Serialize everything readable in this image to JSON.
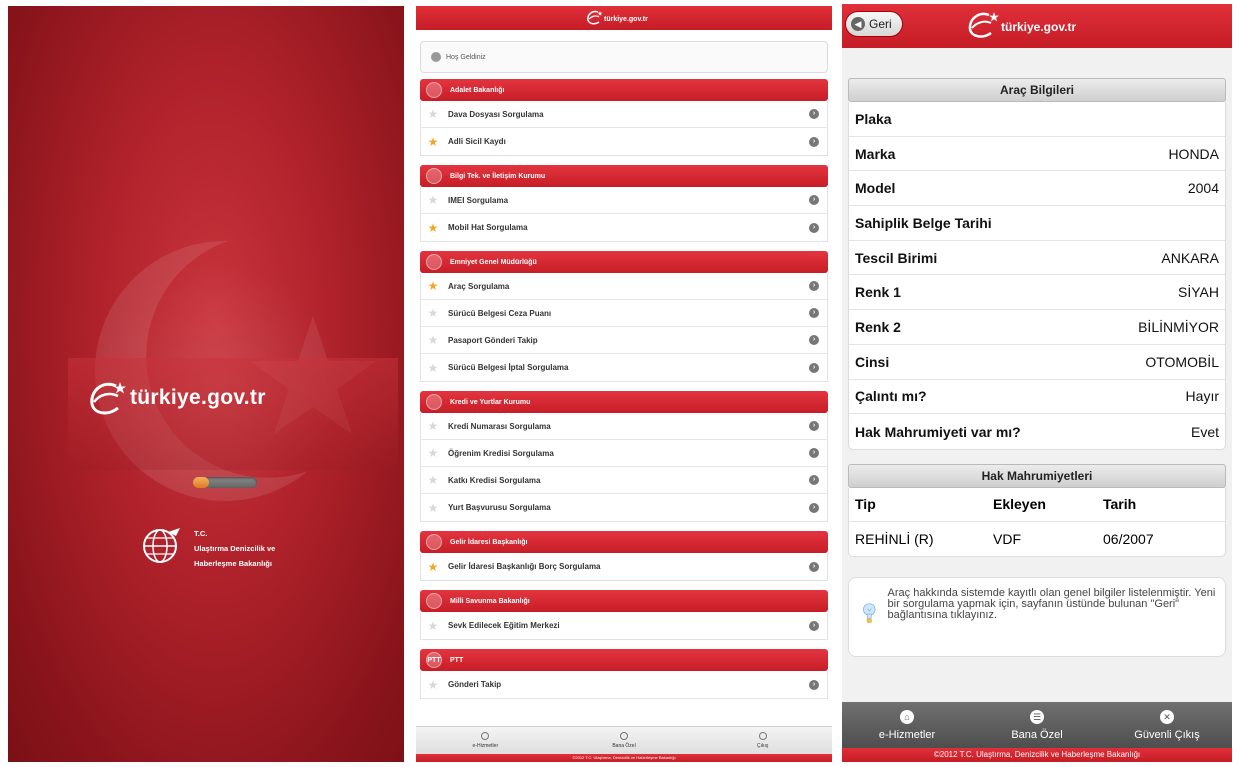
{
  "colors": {
    "brand_red": "#c51c26",
    "star_active": "#f4a623"
  },
  "splash": {
    "logo_text": "türkiye.gov.tr",
    "progress": 0.25,
    "ministry_lines": [
      "T.C.",
      "Ulaştırma Denizcilik ve",
      "Haberleşme Bakanlığı"
    ]
  },
  "list": {
    "welcome_text": "Hoş Geldiniz",
    "groups": [
      {
        "title": "Adalet Bakanlığı",
        "items": [
          {
            "label": "Dava Dosyası Sorgulama",
            "starred": false
          },
          {
            "label": "Adli Sicil Kaydı",
            "starred": true
          }
        ]
      },
      {
        "title": "Bilgi Tek. ve İletişim Kurumu",
        "items": [
          {
            "label": "IMEI Sorgulama",
            "starred": false
          },
          {
            "label": "Mobil Hat Sorgulama",
            "starred": true
          }
        ]
      },
      {
        "title": "Emniyet Genel Müdürlüğü",
        "items": [
          {
            "label": "Araç Sorgulama",
            "starred": true
          },
          {
            "label": "Sürücü Belgesi Ceza Puanı",
            "starred": false
          },
          {
            "label": "Pasaport Gönderi Takip",
            "starred": false
          },
          {
            "label": "Sürücü Belgesi İptal Sorgulama",
            "starred": false
          }
        ]
      },
      {
        "title": "Kredi ve Yurtlar Kurumu",
        "items": [
          {
            "label": "Kredi Numarası Sorgulama",
            "starred": false
          },
          {
            "label": "Öğrenim Kredisi Sorgulama",
            "starred": false
          },
          {
            "label": "Katkı Kredisi Sorgulama",
            "starred": false
          },
          {
            "label": "Yurt Başvurusu Sorgulama",
            "starred": false
          }
        ]
      },
      {
        "title": "Gelir İdaresi Başkanlığı",
        "items": [
          {
            "label": "Gelir İdaresi Başkanlığı Borç Sorgulama",
            "starred": true
          }
        ]
      },
      {
        "title": "Milli Savunma Bakanlığı",
        "items": [
          {
            "label": "Sevk Edilecek Eğitim Merkezi",
            "starred": false
          }
        ]
      },
      {
        "title": "PTT",
        "emblem": "PTT",
        "items": [
          {
            "label": "Gönderi Takip",
            "starred": false
          }
        ]
      }
    ],
    "tabs": [
      "e-Hizmetler",
      "Bana Özel",
      "Çıkış"
    ],
    "footer": "©2012 T.C. Ulaştırma, Denizcilik ve Haberleşme Bakanlığı"
  },
  "detail": {
    "back_label": "Geri",
    "logo_text": "türkiye.gov.tr",
    "vehicle_section_title": "Araç Bilgileri",
    "vehicle_fields": [
      {
        "key": "Plaka",
        "value": ""
      },
      {
        "key": "Marka",
        "value": "HONDA"
      },
      {
        "key": "Model",
        "value": "2004"
      },
      {
        "key": "Sahiplik Belge Tarihi",
        "value": ""
      },
      {
        "key": "Tescil Birimi",
        "value": "ANKARA"
      },
      {
        "key": "Renk 1",
        "value": "SİYAH"
      },
      {
        "key": "Renk 2",
        "value": "BİLİNMİYOR"
      },
      {
        "key": "Cinsi",
        "value": "OTOMOBİL"
      },
      {
        "key": "Çalıntı mı?",
        "value": "Hayır"
      },
      {
        "key": "Hak Mahrumiyeti var mı?",
        "value": "Evet"
      }
    ],
    "restrictions_title": "Hak Mahrumiyetleri",
    "restrictions_columns": [
      "Tip",
      "Ekleyen",
      "Tarih"
    ],
    "restrictions_rows": [
      [
        "REHİNLİ (R)",
        "VDF",
        "06/2007"
      ]
    ],
    "info_text": "Araç hakkında sistemde kayıtlı olan genel bilgiler listelenmiştir. Yeni bir sorgulama yapmak için, sayfanın üstünde bulunan \"Geri\" bağlantısına tıklayınız.",
    "tabs": [
      "e-Hizmetler",
      "Bana Özel",
      "Güvenli Çıkış"
    ],
    "footer": "©2012 T.C. Ulaştırma, Denizcilik ve Haberleşme Bakanlığı"
  }
}
